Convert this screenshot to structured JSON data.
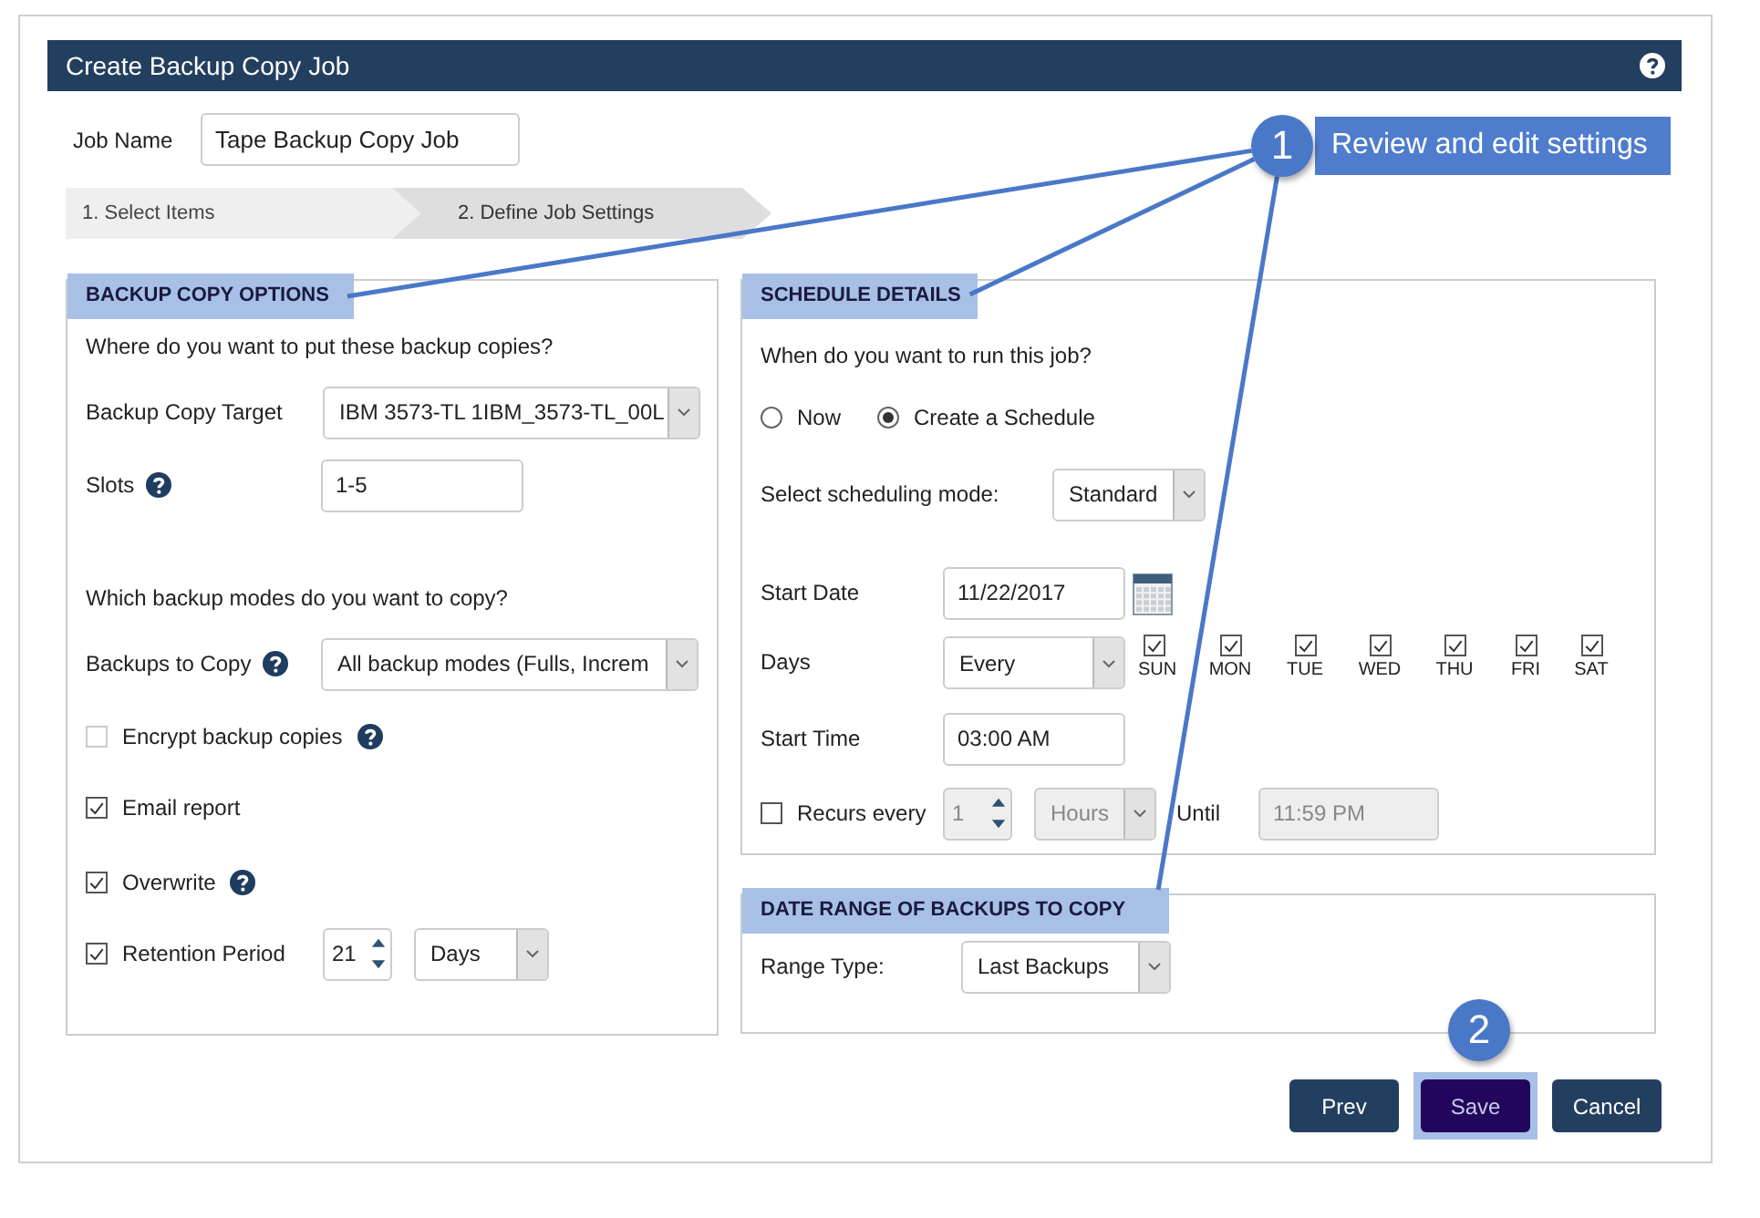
{
  "window": {
    "title": "Create Backup Copy Job"
  },
  "job_name": {
    "label": "Job Name",
    "value": "Tape Backup Copy Job"
  },
  "steps": [
    {
      "label": "1. Select Items",
      "selected": false
    },
    {
      "label": "2. Define Job Settings",
      "selected": true
    }
  ],
  "backup_copy_options": {
    "title": "BACKUP COPY OPTIONS",
    "target_question": "Where do you want to put these backup copies?",
    "target": {
      "label": "Backup Copy Target",
      "value": "IBM 3573-TL 1IBM_3573-TL_00L"
    },
    "slots": {
      "label": "Slots",
      "value": "1-5"
    },
    "modes_question": "Which backup modes do you want to copy?",
    "backups_to_copy": {
      "label": "Backups to Copy",
      "value": "All backup modes (Fulls, Increm"
    },
    "options": [
      {
        "label": "Encrypt backup copies",
        "checked": false,
        "help": true
      },
      {
        "label": "Email report",
        "checked": true,
        "help": false
      },
      {
        "label": "Overwrite",
        "checked": true,
        "help": true
      },
      {
        "label": "Retention Period",
        "checked": true,
        "help": false
      }
    ],
    "retention": {
      "value": "21",
      "unit": "Days"
    }
  },
  "schedule_details": {
    "title": "SCHEDULE DETAILS",
    "question": "When do you want to run this job?",
    "run_options": [
      {
        "label": "Now",
        "selected": false
      },
      {
        "label": "Create a Schedule",
        "selected": true
      }
    ],
    "mode": {
      "label": "Select scheduling mode:",
      "value": "Standard"
    },
    "start_date": {
      "label": "Start Date",
      "value": "11/22/2017"
    },
    "days": {
      "label": "Days",
      "value": "Every",
      "weekdays": [
        {
          "label": "SUN",
          "checked": true
        },
        {
          "label": "MON",
          "checked": true
        },
        {
          "label": "TUE",
          "checked": true
        },
        {
          "label": "WED",
          "checked": true
        },
        {
          "label": "THU",
          "checked": true
        },
        {
          "label": "FRI",
          "checked": true
        },
        {
          "label": "SAT",
          "checked": true
        }
      ]
    },
    "start_time": {
      "label": "Start Time",
      "value": "03:00 AM"
    },
    "recurs": {
      "label": "Recurs every",
      "checked": false,
      "interval": "1",
      "unit": "Hours",
      "until_label": "Until",
      "until": "11:59 PM",
      "disabled": true
    }
  },
  "date_range": {
    "title": "DATE RANGE OF BACKUPS TO COPY",
    "range_type": {
      "label": "Range Type:",
      "value": "Last Backups"
    }
  },
  "buttons": [
    {
      "label": "Prev",
      "focused": false
    },
    {
      "label": "Save",
      "focused": true
    },
    {
      "label": "Cancel",
      "focused": false
    }
  ],
  "callouts": [
    {
      "number": "1",
      "text": "Review and edit settings"
    },
    {
      "number": "2"
    }
  ]
}
